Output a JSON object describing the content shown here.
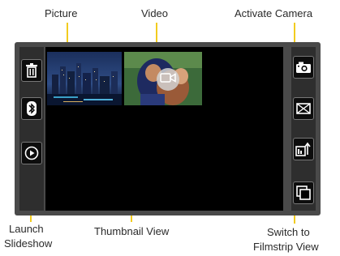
{
  "callouts": {
    "picture": "Picture",
    "video": "Video",
    "activate_camera": "Activate Camera",
    "launch_slideshow_line1": "Launch",
    "launch_slideshow_line2": "Slideshow",
    "thumbnail_view": "Thumbnail View",
    "switch_filmstrip_line1": "Switch to",
    "switch_filmstrip_line2": "Filmstrip View"
  },
  "left_toolbar": {
    "items": [
      {
        "icon": "trash-icon"
      },
      {
        "icon": "bluetooth-icon"
      },
      {
        "icon": "play-slideshow-icon"
      }
    ]
  },
  "right_toolbar": {
    "items": [
      {
        "icon": "camera-icon"
      },
      {
        "icon": "mail-icon"
      },
      {
        "icon": "share-icon"
      },
      {
        "icon": "filmstrip-view-icon"
      }
    ]
  },
  "thumbnails": [
    {
      "type": "picture"
    },
    {
      "type": "video",
      "overlay_icon": "video-camera-icon"
    }
  ],
  "colors": {
    "callout_line": "#f2cc1f",
    "device_frame": "#4a4a4a",
    "screen": "#000000"
  }
}
